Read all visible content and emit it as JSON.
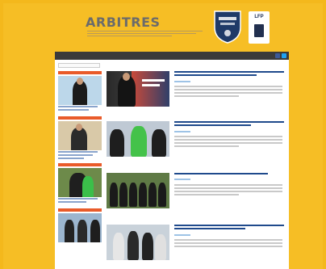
{
  "header": {
    "logo_small": "",
    "logo_title": "ARBITRES",
    "fff_badge": "shield-badge-icon",
    "lfp_label": "LFP"
  },
  "nav": {
    "items": [
      "",
      "",
      "",
      "",
      "",
      "",
      "",
      ""
    ]
  },
  "sidebar": {
    "search_placeholder": ""
  },
  "main": {
    "breadcrumb": ""
  },
  "colors": {
    "page_background": "#f4b81c",
    "nav_background": "#3a3a3a",
    "accent_orange": "#e95b2a",
    "link_blue": "#1f4a8c",
    "facebook_blue": "#3b5998",
    "twitter_blue": "#1da1f2"
  }
}
